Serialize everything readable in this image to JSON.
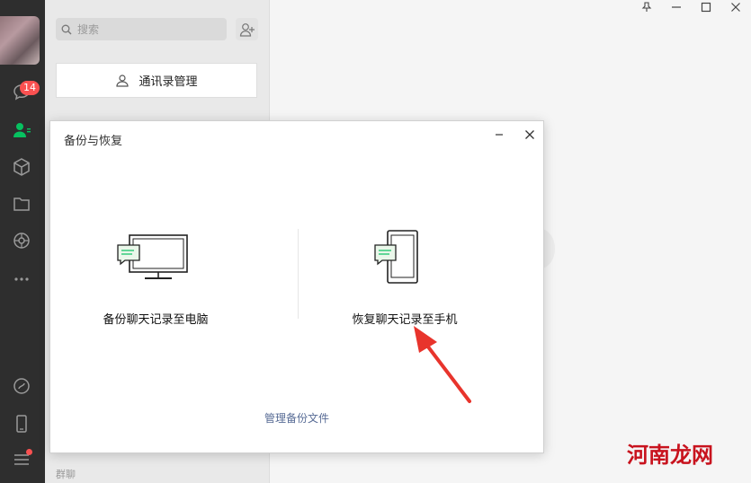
{
  "sidebar": {
    "chat_badge_count": "14"
  },
  "contact_panel": {
    "search_placeholder": "搜索",
    "contacts_manage_label": "通讯录管理",
    "group_label": "群聊"
  },
  "dialog": {
    "title": "备份与恢复",
    "backup_option_label": "备份聊天记录至电脑",
    "restore_option_label": "恢复聊天记录至手机",
    "manage_backup_link": "管理备份文件"
  },
  "annotation": {
    "arrow_color": "#e8342c"
  },
  "watermark": {
    "text": "河南龙网"
  },
  "colors": {
    "accent_green": "#07c160",
    "badge_red": "#fa5151",
    "link_blue": "#576b95"
  }
}
